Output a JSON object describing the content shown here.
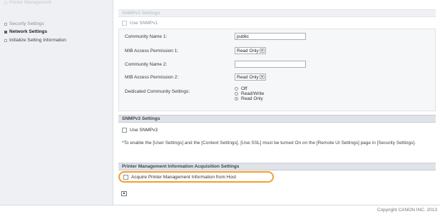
{
  "sidebar": {
    "items": [
      {
        "label": "Printer Management"
      },
      {
        "label": "Security Settings"
      },
      {
        "label": "Network Settings"
      },
      {
        "label": "Initialize Setting Information"
      }
    ]
  },
  "snmpv1": {
    "heading": "SNMPv1 Settings",
    "use_label": "Use SNMPv1",
    "rows": [
      {
        "label": "Community Name 1:",
        "value": "public"
      },
      {
        "label": "MIB Access Permission 1:",
        "value": "Read Only"
      },
      {
        "label": "Community Name 2:",
        "value": ""
      },
      {
        "label": "MIB Access Permission 2:",
        "value": "Read Only"
      }
    ],
    "dedicated": {
      "label": "Dedicated Community Settings:",
      "options": [
        "Off",
        "Read/Write",
        "Read Only"
      ],
      "selected": "Read Only"
    }
  },
  "snmpv3": {
    "heading": "SNMPv3 Settings",
    "use_label": "Use SNMPv3",
    "note": "*To enable the [User Settings] and the [Context Settings], [Use SSL] must be turned On on the [Remote UI Settings] page in [Security Settings]."
  },
  "printer_mgmt": {
    "heading": "Printer Management Information Acquisition Settings",
    "acquire_label": "Acquire Printer Management Information from Host"
  },
  "footer": {
    "copyright": "Copyright CANON INC. 2013"
  }
}
